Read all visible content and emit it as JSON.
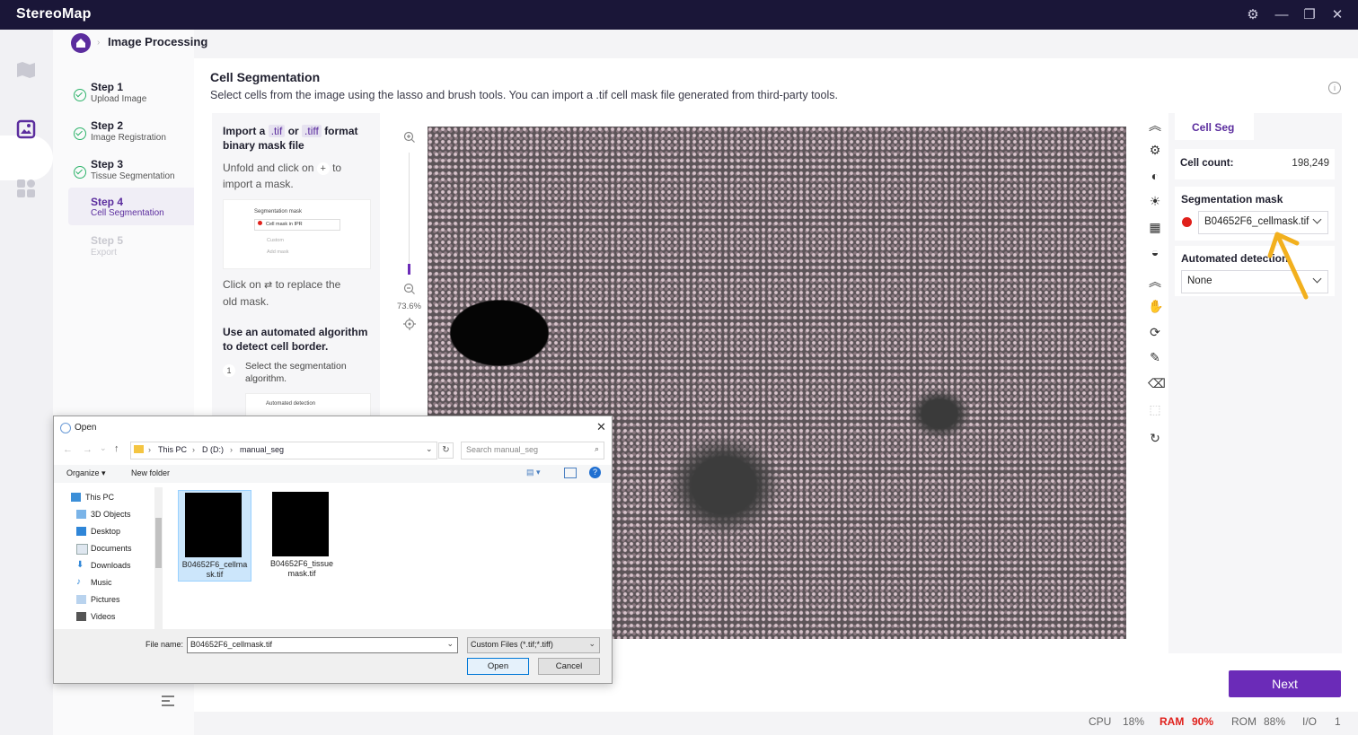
{
  "app": {
    "title": "StereoMap"
  },
  "breadcrumb": {
    "current": "Image Processing"
  },
  "steps": [
    {
      "title": "Step 1",
      "subtitle": "Upload Image"
    },
    {
      "title": "Step 2",
      "subtitle": "Image Registration"
    },
    {
      "title": "Step 3",
      "subtitle": "Tissue Segmentation"
    },
    {
      "title": "Step 4",
      "subtitle": "Cell Segmentation"
    },
    {
      "title": "Step 5",
      "subtitle": "Export"
    }
  ],
  "main": {
    "title": "Cell Segmentation",
    "description": "Select cells from the image using the lasso and brush tools. You can import a .tif cell mask file generated from third-party tools."
  },
  "help": {
    "import_a": "Import a",
    "ext_tif": ".tif",
    "or": "or",
    "ext_tiff": ".tiff",
    "format": "format",
    "binary_mask": "binary mask file",
    "unfold_1": "Unfold and click on",
    "unfold_2": "to",
    "unfold_3": "import a mask.",
    "thumb1_title": "Segmentation mask",
    "thumb1_value": "Cell mask in IPR",
    "thumb1_custom": "Custom",
    "thumb1_add": "Add mask",
    "replace_1": "Click on",
    "replace_2": "to replace the",
    "replace_3": "old mask.",
    "auto_title_1": "Use an automated algorithm",
    "auto_title_2": "to detect cell border.",
    "step_num": "1",
    "step_text_1": "Select the segmentation",
    "step_text_2": "algorithm.",
    "thumb2_title": "Automated detection"
  },
  "zoom": {
    "level": "73.6%"
  },
  "right_panel": {
    "tab": "Cell Seg",
    "cell_count_label": "Cell count:",
    "cell_count_value": "198,249",
    "seg_mask_label": "Segmentation mask",
    "seg_mask_value": "B04652F6_cellmask.tif",
    "auto_label": "Automated detection",
    "auto_value": "None"
  },
  "next_label": "Next",
  "status": {
    "cpu_label": "CPU",
    "cpu_value": "18%",
    "ram_label": "RAM",
    "ram_value": "90%",
    "rom_label": "ROM",
    "rom_value": "88%",
    "io_label": "I/O",
    "io_value": "1"
  },
  "colors": {
    "accent": "#6b2bb8",
    "titlebar": "#1a1638",
    "ram_alert": "#e0201b",
    "arrow": "#f2b01e"
  },
  "dialog": {
    "title": "Open",
    "path": [
      "This PC",
      "D (D:)",
      "manual_seg"
    ],
    "search_placeholder": "Search manual_seg",
    "organize": "Organize",
    "new_folder": "New folder",
    "tree": [
      "This PC",
      "3D Objects",
      "Desktop",
      "Documents",
      "Downloads",
      "Music",
      "Pictures",
      "Videos"
    ],
    "files": [
      "B04652F6_cellmask.tif",
      "B04652F6_tissuemask.tif"
    ],
    "filename_label": "File name:",
    "filename_value": "B04652F6_cellmask.tif",
    "filter_value": "Custom Files (*.tif;*.tiff)",
    "open_label": "Open",
    "cancel_label": "Cancel"
  }
}
